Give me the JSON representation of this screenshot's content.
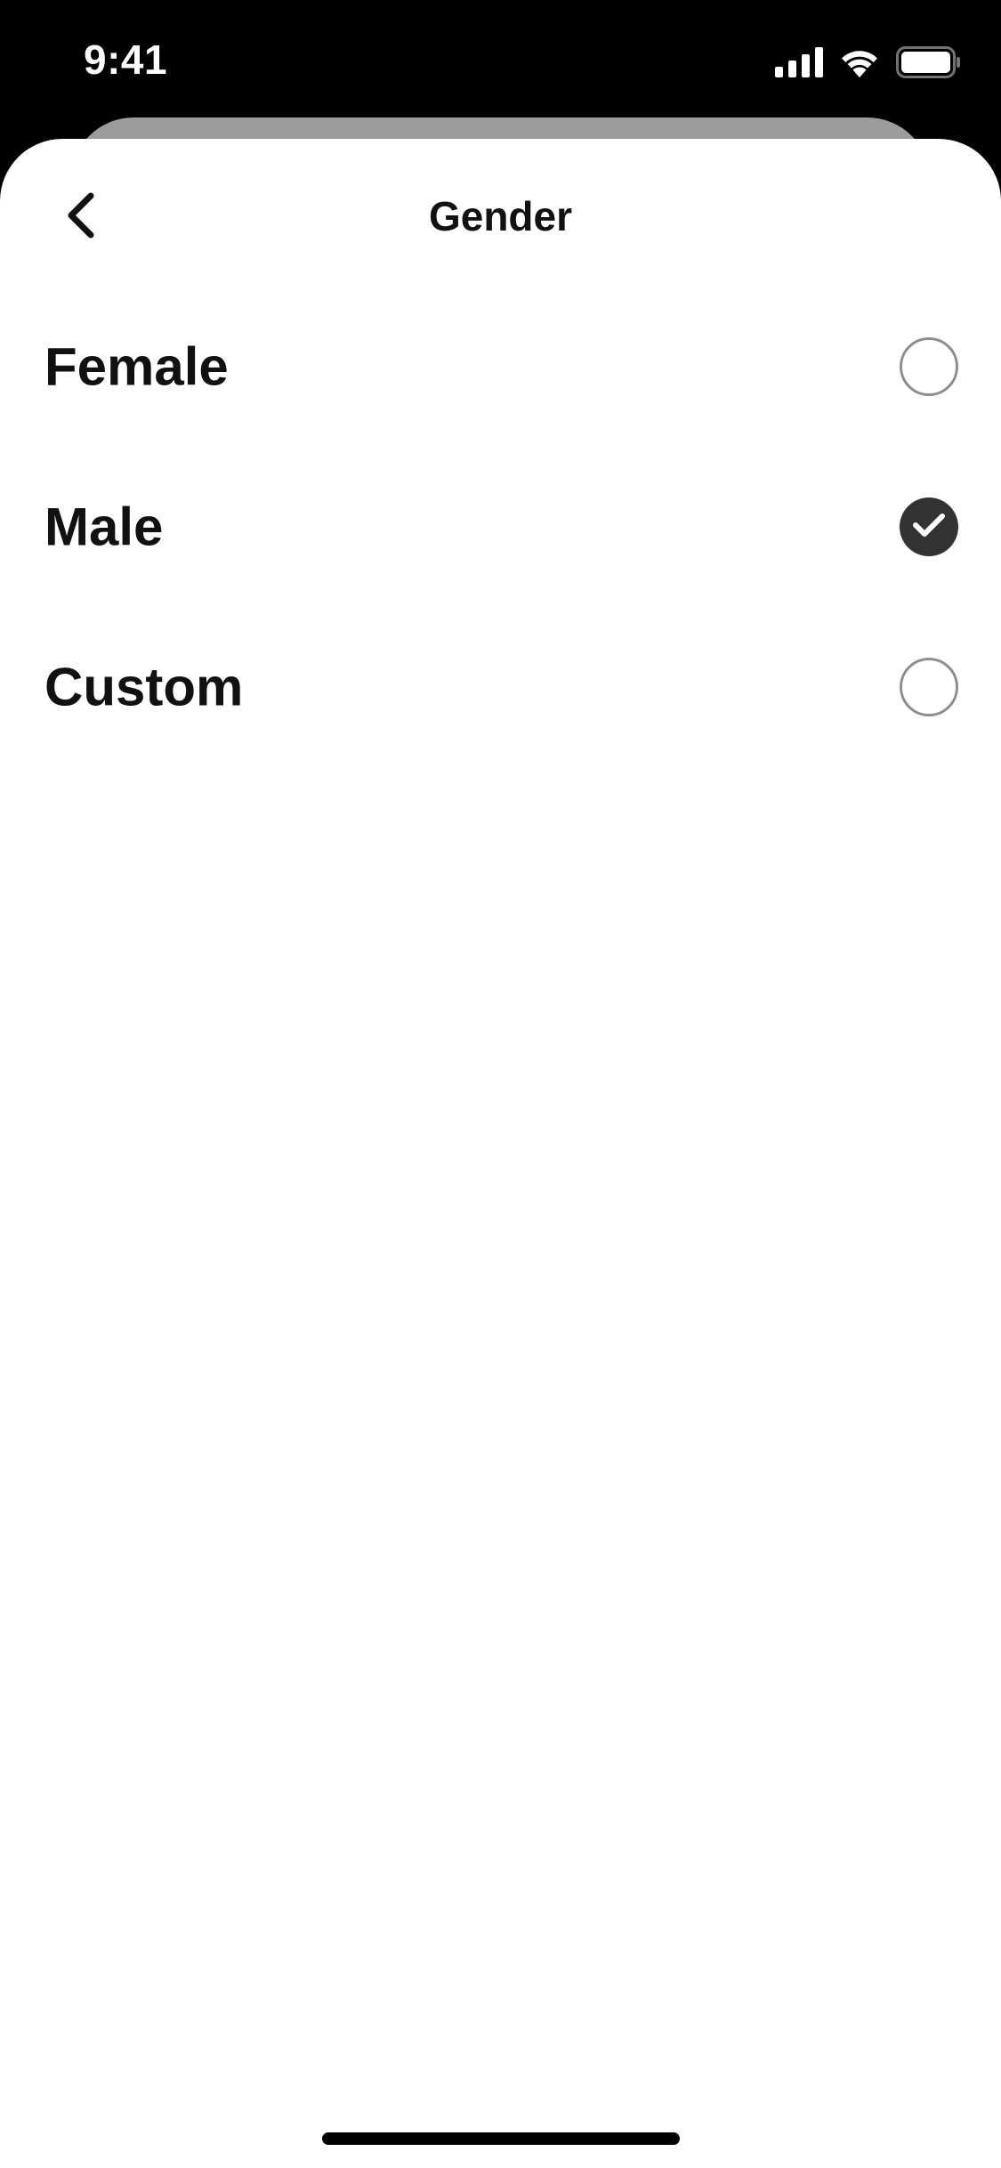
{
  "status_bar": {
    "time": "9:41",
    "icons": [
      "cellular-signal-icon",
      "wifi-icon",
      "battery-icon"
    ]
  },
  "header": {
    "title": "Gender",
    "back_icon": "chevron-left-icon"
  },
  "options": [
    {
      "label": "Female",
      "selected": false
    },
    {
      "label": "Male",
      "selected": true
    },
    {
      "label": "Custom",
      "selected": false
    }
  ],
  "colors": {
    "text": "#111111",
    "radio_checked": "#333333",
    "radio_border": "#8e8e8e",
    "background_card": "#9c9c9c"
  }
}
